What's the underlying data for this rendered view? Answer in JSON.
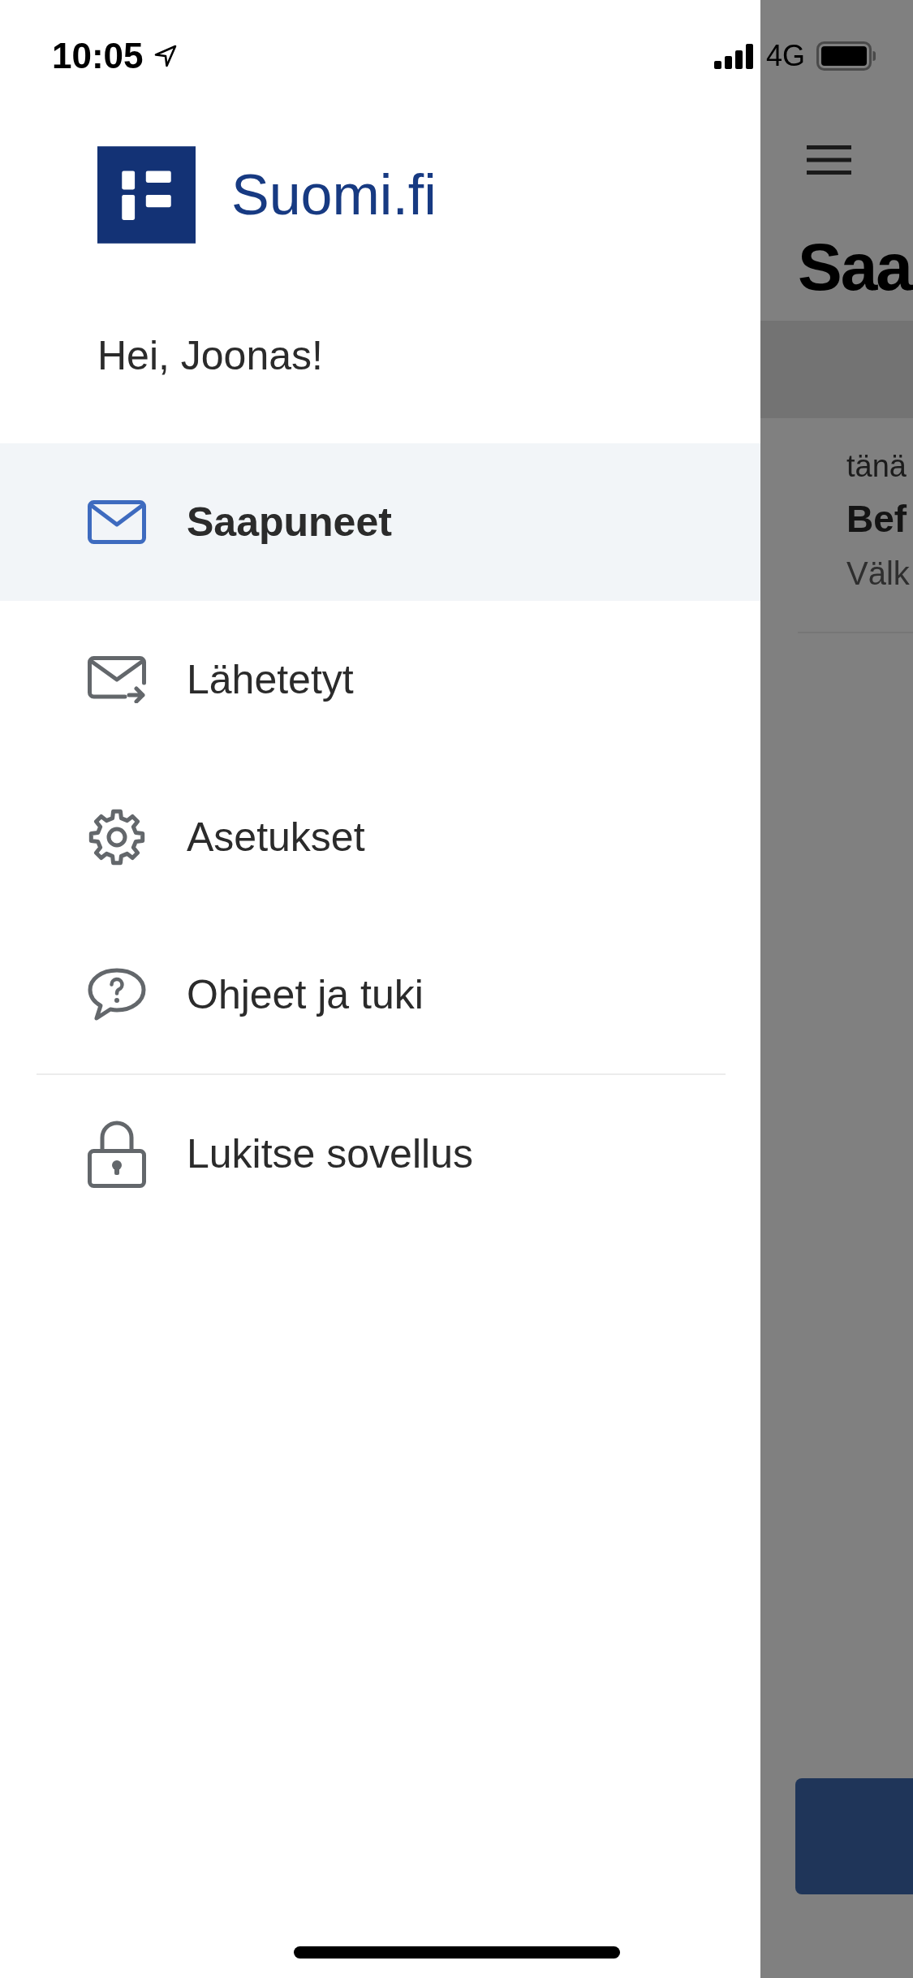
{
  "status_bar": {
    "time": "10:05",
    "network": "4G"
  },
  "drawer": {
    "logo": {
      "text": "Suomi.fi"
    },
    "greeting": "Hei, Joonas!",
    "menu": {
      "sections": [
        {
          "items": [
            {
              "kind": "inbox",
              "label": "Saapuneet",
              "selected": true
            },
            {
              "kind": "sent",
              "label": "Lähetetyt",
              "selected": false
            },
            {
              "kind": "settings",
              "label": "Asetukset",
              "selected": false
            },
            {
              "kind": "help",
              "label": "Ohjeet ja tuki",
              "selected": false
            }
          ]
        },
        {
          "items": [
            {
              "kind": "lock",
              "label": "Lukitse sovellus",
              "selected": false
            }
          ]
        }
      ]
    }
  },
  "background_screen": {
    "title": "Saa",
    "message": {
      "line_1": "tänä",
      "line_2": "Bef",
      "line_3": "Välk"
    }
  }
}
